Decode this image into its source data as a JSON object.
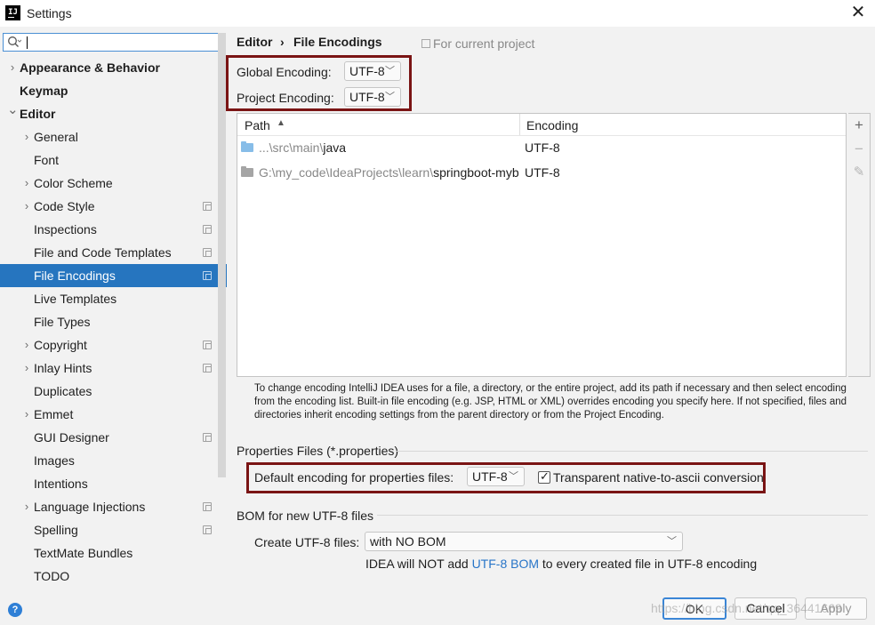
{
  "window": {
    "title": "Settings",
    "app_icon": "intellij-idea-icon",
    "close_label": "✕"
  },
  "search": {
    "value": "",
    "placeholder": ""
  },
  "sidebar": {
    "items": [
      {
        "label": "Appearance & Behavior",
        "expandable": true,
        "expanded": false,
        "bold": true,
        "level": 0,
        "project_icon": false
      },
      {
        "label": "Keymap",
        "expandable": false,
        "bold": true,
        "level": 0,
        "project_icon": false
      },
      {
        "label": "Editor",
        "expandable": true,
        "expanded": true,
        "bold": true,
        "level": 0,
        "project_icon": false
      },
      {
        "label": "General",
        "expandable": true,
        "expanded": false,
        "bold": false,
        "level": 1,
        "project_icon": false
      },
      {
        "label": "Font",
        "expandable": false,
        "bold": false,
        "level": 1,
        "project_icon": false
      },
      {
        "label": "Color Scheme",
        "expandable": true,
        "expanded": false,
        "bold": false,
        "level": 1,
        "project_icon": false
      },
      {
        "label": "Code Style",
        "expandable": true,
        "expanded": false,
        "bold": false,
        "level": 1,
        "project_icon": true
      },
      {
        "label": "Inspections",
        "expandable": false,
        "bold": false,
        "level": 1,
        "project_icon": true
      },
      {
        "label": "File and Code Templates",
        "expandable": false,
        "bold": false,
        "level": 1,
        "project_icon": true
      },
      {
        "label": "File Encodings",
        "expandable": false,
        "bold": false,
        "level": 1,
        "project_icon": true,
        "selected": true
      },
      {
        "label": "Live Templates",
        "expandable": false,
        "bold": false,
        "level": 1,
        "project_icon": false
      },
      {
        "label": "File Types",
        "expandable": false,
        "bold": false,
        "level": 1,
        "project_icon": false
      },
      {
        "label": "Copyright",
        "expandable": true,
        "expanded": false,
        "bold": false,
        "level": 1,
        "project_icon": true
      },
      {
        "label": "Inlay Hints",
        "expandable": true,
        "expanded": false,
        "bold": false,
        "level": 1,
        "project_icon": true
      },
      {
        "label": "Duplicates",
        "expandable": false,
        "bold": false,
        "level": 1,
        "project_icon": false
      },
      {
        "label": "Emmet",
        "expandable": true,
        "expanded": false,
        "bold": false,
        "level": 1,
        "project_icon": false
      },
      {
        "label": "GUI Designer",
        "expandable": false,
        "bold": false,
        "level": 1,
        "project_icon": true
      },
      {
        "label": "Images",
        "expandable": false,
        "bold": false,
        "level": 1,
        "project_icon": false
      },
      {
        "label": "Intentions",
        "expandable": false,
        "bold": false,
        "level": 1,
        "project_icon": false
      },
      {
        "label": "Language Injections",
        "expandable": true,
        "expanded": false,
        "bold": false,
        "level": 1,
        "project_icon": true
      },
      {
        "label": "Spelling",
        "expandable": false,
        "bold": false,
        "level": 1,
        "project_icon": true
      },
      {
        "label": "TextMate Bundles",
        "expandable": false,
        "bold": false,
        "level": 1,
        "project_icon": false
      },
      {
        "label": "TODO",
        "expandable": false,
        "bold": false,
        "level": 1,
        "project_icon": false
      }
    ]
  },
  "breadcrumb": {
    "parent": "Editor",
    "separator": "›",
    "current": "File Encodings",
    "scope_label": "For current project"
  },
  "encodings": {
    "global_label": "Global Encoding:",
    "global_value": "UTF-8",
    "project_label": "Project Encoding:",
    "project_value": "UTF-8"
  },
  "table": {
    "columns": [
      "Path",
      "Encoding"
    ],
    "sort_indicator": "▲",
    "rows": [
      {
        "path_prefix": "...\\src\\main\\",
        "path_name": "java",
        "encoding": "UTF-8",
        "folder_color": "#87bde8"
      },
      {
        "path_prefix": "G:\\my_code\\IdeaProjects\\learn\\",
        "path_name": "springboot-myb",
        "encoding": "UTF-8",
        "folder_color": "#a5a5a5"
      }
    ],
    "toolbar": {
      "add": "+",
      "remove": "−",
      "edit": "✎"
    }
  },
  "hint_text": "To change encoding IntelliJ IDEA uses for a file, a directory, or the entire project, add its path if necessary and then select encoding from the encoding list. Built-in file encoding (e.g. JSP, HTML or XML) overrides encoding you specify here. If not specified, files and directories inherit encoding settings from the parent directory or from the Project Encoding.",
  "properties": {
    "section_title": "Properties Files (*.properties)",
    "default_label": "Default encoding for properties files:",
    "default_value": "UTF-8",
    "transparent_checked": true,
    "transparent_label": "Transparent native-to-ascii conversion"
  },
  "bom": {
    "section_title": "BOM for new UTF-8 files",
    "create_label": "Create UTF-8 files:",
    "create_value": "with NO BOM",
    "note_before": "IDEA will NOT add ",
    "note_link": "UTF-8 BOM",
    "note_after": " to every created file in UTF-8 encoding"
  },
  "footer": {
    "help": "?",
    "ok": "OK",
    "cancel": "Cancel",
    "apply": "Apply",
    "watermark": "https://blog.csdn.net/qq_36441669"
  },
  "colors": {
    "selection": "#2675bf",
    "highlight_border": "#7a1414",
    "link": "#2875c8",
    "help": "#2e7fd6"
  }
}
